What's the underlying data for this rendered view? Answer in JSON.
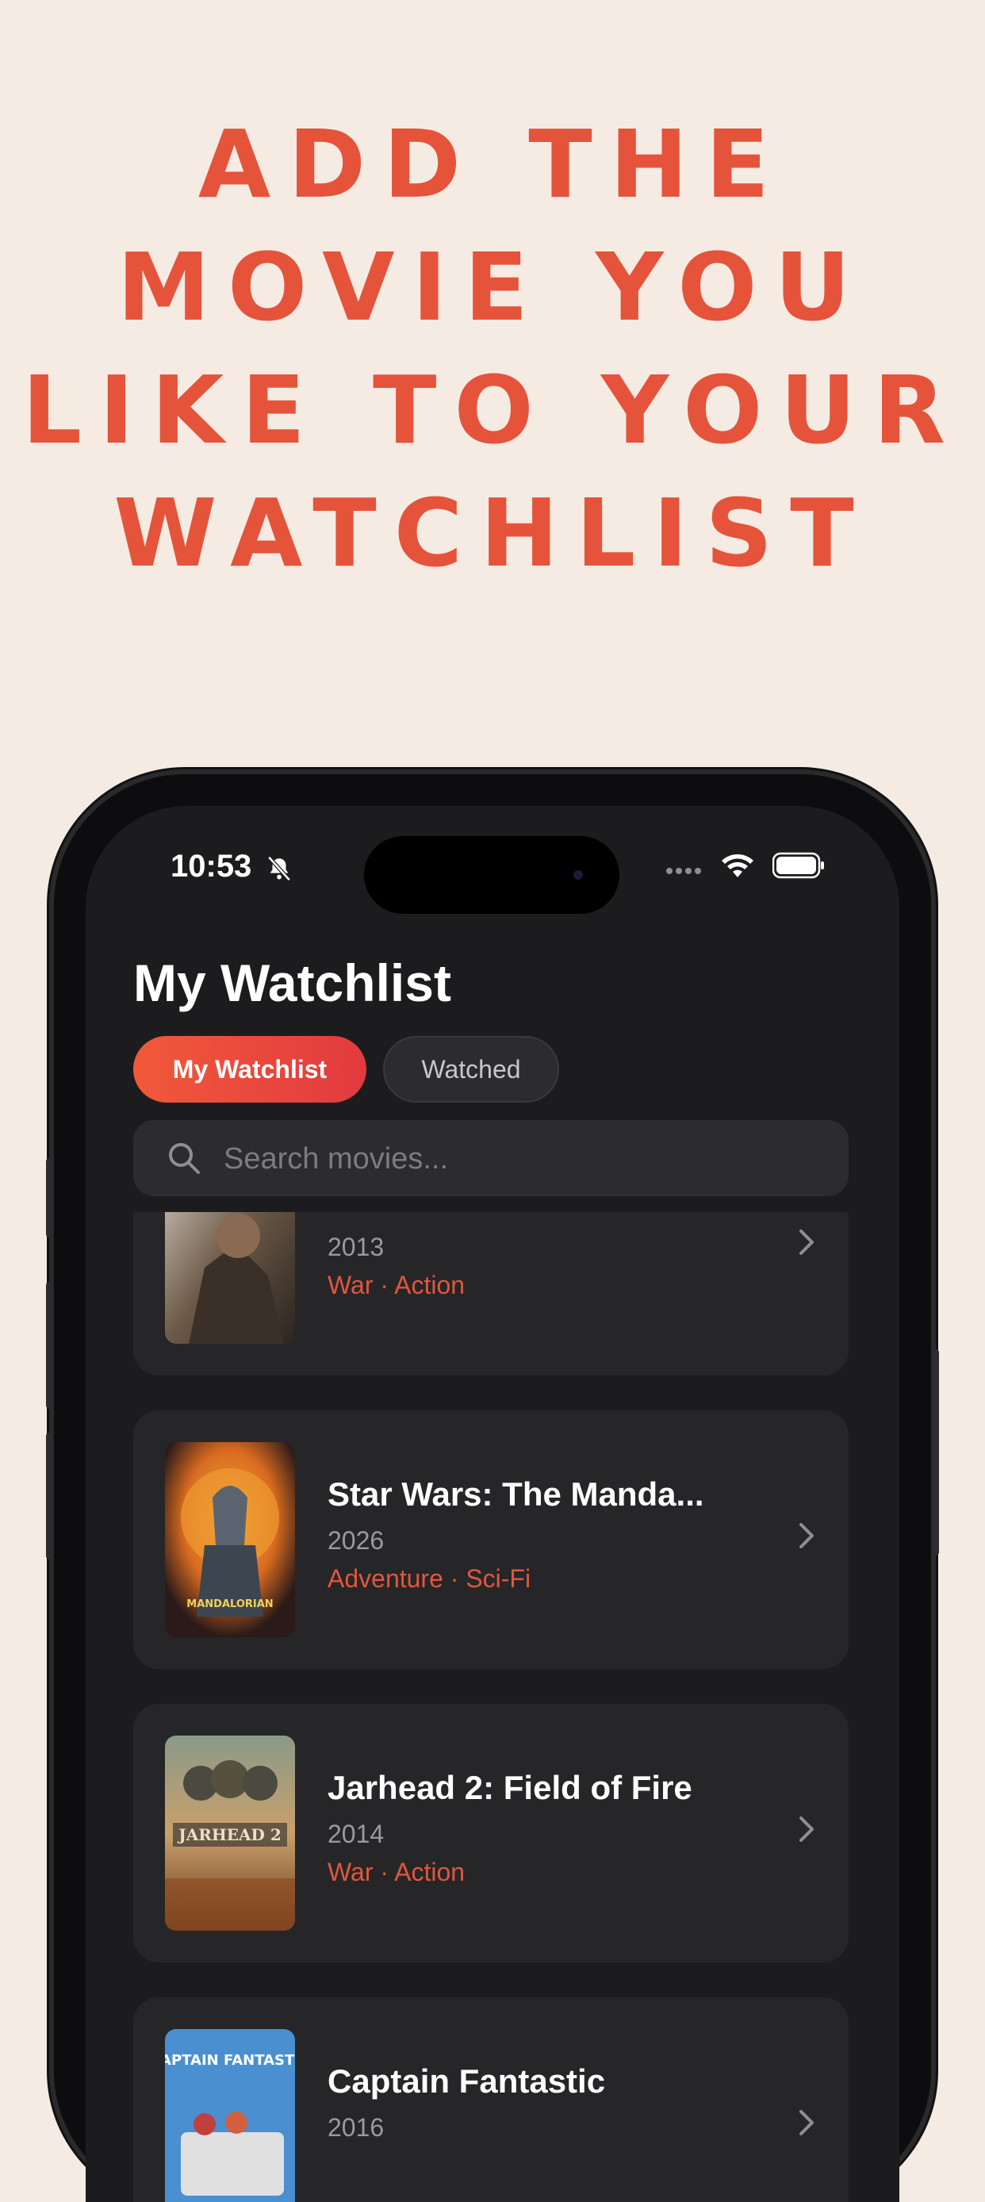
{
  "headline": {
    "lines": [
      "ADD THE",
      "MOVIE YOU",
      "LIKE TO YOUR",
      "WATCHLIST"
    ]
  },
  "status_bar": {
    "time": "10:53",
    "icons": [
      "bell-slash-icon",
      "signal-icon",
      "wifi-icon",
      "battery-icon"
    ]
  },
  "screen": {
    "title": "My Watchlist",
    "tabs": [
      {
        "label": "My Watchlist",
        "active": true
      },
      {
        "label": "Watched",
        "active": false
      }
    ],
    "search": {
      "placeholder": "Search movies..."
    },
    "movies": [
      {
        "title": "",
        "year": "2013",
        "genres": "War · Action"
      },
      {
        "title": "Star Wars: The Manda...",
        "year": "2026",
        "genres": "Adventure · Sci-Fi"
      },
      {
        "title": "Jarhead 2: Field of Fire",
        "year": "2014",
        "genres": "War · Action"
      },
      {
        "title": "Captain Fantastic",
        "year": "2016",
        "genres": ""
      }
    ],
    "posters": [
      {
        "lettering": ""
      },
      {
        "lettering": "MANDALORIAN"
      },
      {
        "lettering": "JARHEAD 2"
      },
      {
        "lettering": "CAPTAIN FANTASTIC"
      }
    ]
  },
  "colors": {
    "background": "#f5ebe2",
    "accent": "#e5533b",
    "screen_bg": "#1c1c1e",
    "card_bg": "#262628"
  }
}
